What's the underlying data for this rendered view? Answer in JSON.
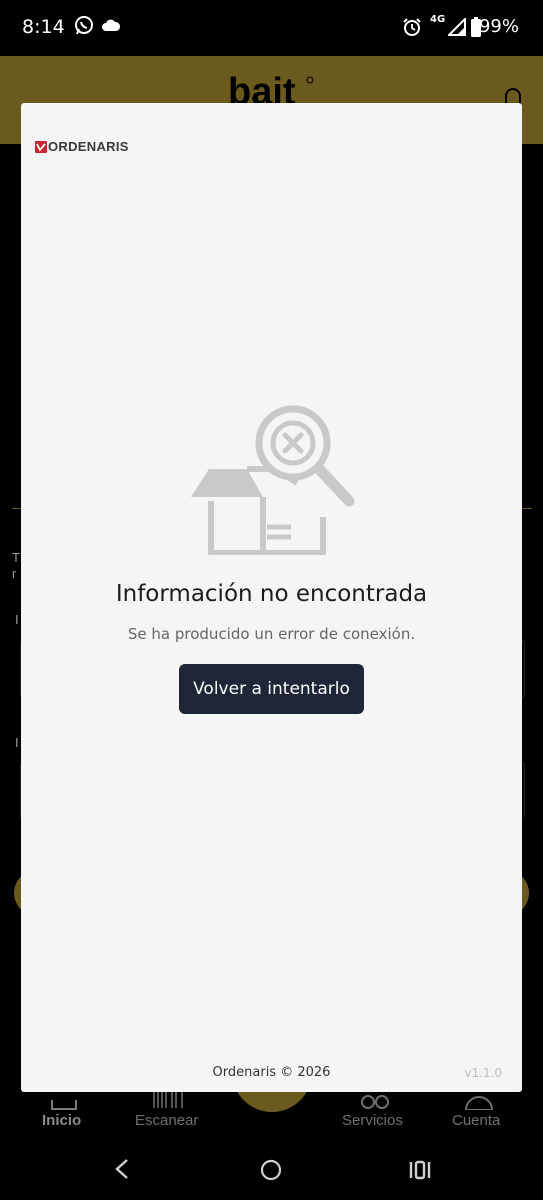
{
  "status_bar": {
    "time": "8:14",
    "network": "4G",
    "battery": "99%",
    "icons": [
      "whatsapp-icon",
      "cloud-icon",
      "alarm-icon",
      "signal-icon",
      "battery-icon"
    ]
  },
  "background_app": {
    "logo_text": "bait",
    "fragments": [
      "T",
      "r",
      "I",
      "I"
    ],
    "accent_color": "#6b5a1e",
    "bottom_nav": {
      "items": [
        {
          "label": "Inicio",
          "icon": "home-icon"
        },
        {
          "label": "Escanear",
          "icon": "barcode-icon"
        },
        {
          "label": "Servicios",
          "icon": "services-icon"
        },
        {
          "label": "Cuenta",
          "icon": "account-icon"
        }
      ]
    }
  },
  "modal": {
    "brand": "ORDENARIS",
    "illustration": "box-search-not-found-icon",
    "title": "Información no encontrada",
    "subtitle": "Se ha producido un error de conexión.",
    "retry_label": "Volver a intentarlo",
    "copyright": "Ordenaris © 2026",
    "version": "v1.1.0",
    "button_color": "#1f2637"
  },
  "android_nav": {
    "buttons": [
      "back-icon",
      "home-circle-icon",
      "recents-icon"
    ]
  }
}
